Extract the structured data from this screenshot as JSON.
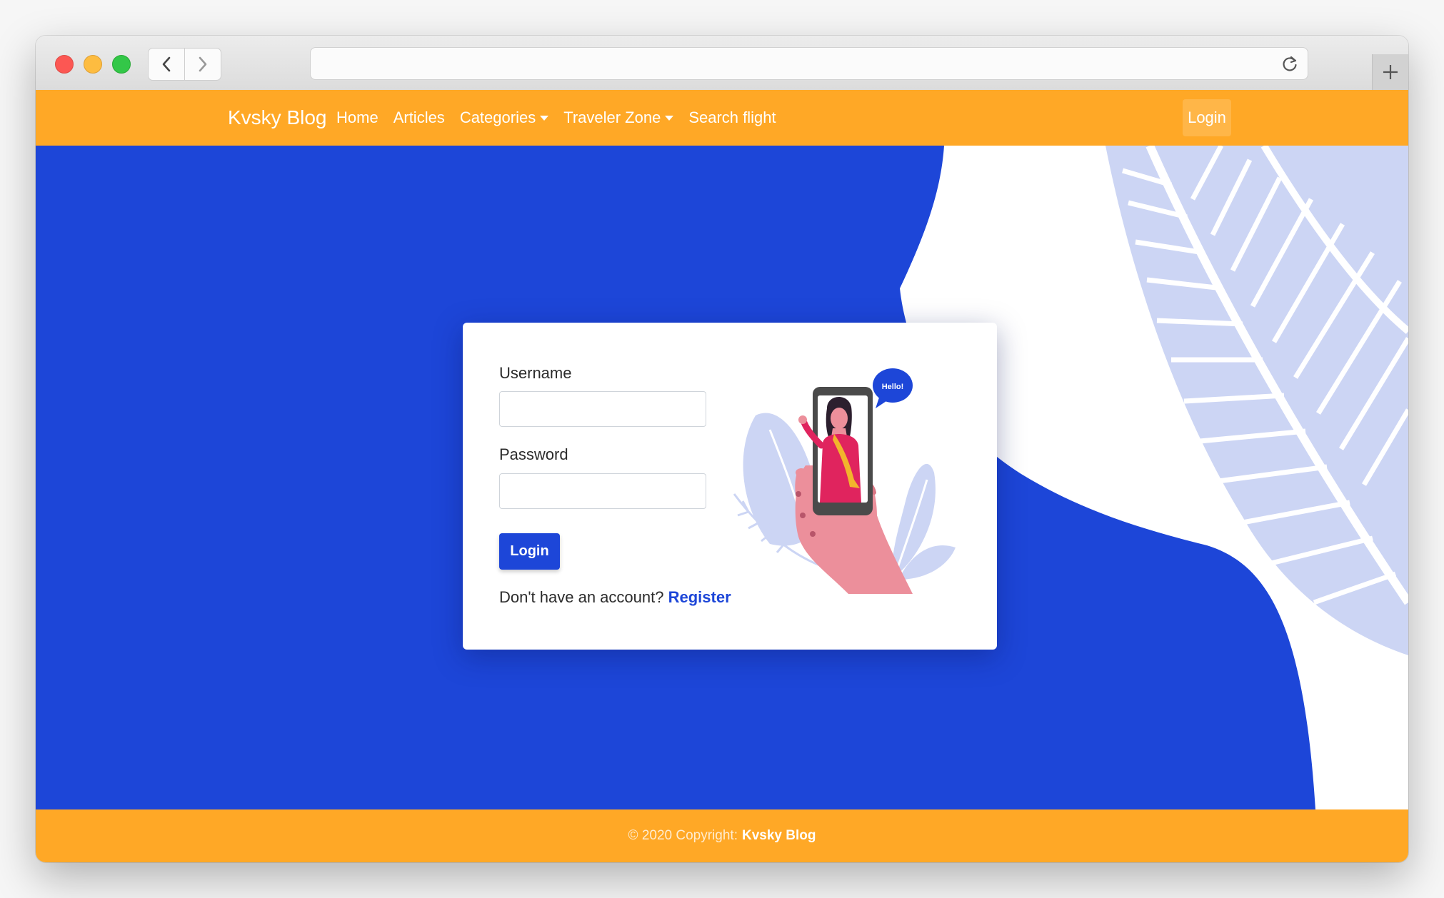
{
  "navbar": {
    "brand": "Kvsky Blog",
    "items": [
      {
        "label": "Home",
        "dropdown": false
      },
      {
        "label": "Articles",
        "dropdown": false
      },
      {
        "label": "Categories",
        "dropdown": true
      },
      {
        "label": "Traveler Zone",
        "dropdown": true
      },
      {
        "label": "Search flight",
        "dropdown": false
      }
    ],
    "login_label": "Login"
  },
  "login_form": {
    "username_label": "Username",
    "username_value": "",
    "password_label": "Password",
    "password_value": "",
    "submit_label": "Login",
    "register_prompt": "Don't have an account?",
    "register_link": "Register"
  },
  "illustration": {
    "bubble_text": "Hello!"
  },
  "footer": {
    "copyright": "© 2020 Copyright:",
    "brand": "Kvsky Blog"
  },
  "colors": {
    "accent_orange": "#ffa826",
    "primary_blue": "#1d46d8",
    "leaf_lavender": "#ccd5f4"
  }
}
